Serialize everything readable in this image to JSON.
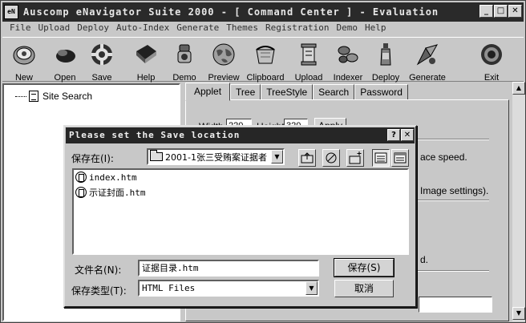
{
  "window": {
    "app_icon_text": "eN",
    "title": "Auscomp eNavigator Suite 2000 - [ Command Center ] - Evaluation",
    "minimize": "_",
    "maximize": "□",
    "close": "✕"
  },
  "menu": [
    "File",
    "Upload",
    "Deploy",
    "Auto-Index",
    "Generate",
    "Themes",
    "Registration",
    "Demo",
    "Help"
  ],
  "toolbar": [
    {
      "label": "New",
      "icon": "new-icon"
    },
    {
      "label": "Open",
      "icon": "open-icon"
    },
    {
      "label": "Save",
      "icon": "save-icon"
    },
    {
      "label": "Help",
      "icon": "help-book-icon"
    },
    {
      "label": "Demo",
      "icon": "demo-icon"
    },
    {
      "label": "Preview",
      "icon": "preview-globe-icon"
    },
    {
      "label": "Clipboard",
      "icon": "clipboard-icon"
    },
    {
      "label": "Upload",
      "icon": "upload-icon"
    },
    {
      "label": "Indexer",
      "icon": "indexer-icon"
    },
    {
      "label": "Deploy",
      "icon": "deploy-icon"
    },
    {
      "label": "Generate",
      "icon": "generate-icon"
    },
    {
      "label": "Exit",
      "icon": "exit-icon"
    }
  ],
  "tree": {
    "item": "Site Search"
  },
  "tabs": [
    "Applet",
    "Tree",
    "TreeStyle",
    "Search",
    "Password"
  ],
  "applet_panel": {
    "width_label": "Width",
    "width_value": "220",
    "height_label": "Height",
    "height_value": "320",
    "apply_label": "Apply",
    "text_speed": "ace speed.",
    "text_image": "Image settings).",
    "text_d": "d."
  },
  "dialog": {
    "title": "Please set the Save location",
    "help": "?",
    "close": "✕",
    "save_in_label": "保存在(I):",
    "save_in_value": "2001-1张三受贿案证据者",
    "files": [
      "index.htm",
      "示证封面.htm"
    ],
    "filename_label": "文件名(N):",
    "filename_value": "证据目录.htm",
    "filetype_label": "保存类型(T):",
    "filetype_value": "HTML Files",
    "save_button": "保存(S)",
    "cancel_button": "取消"
  }
}
